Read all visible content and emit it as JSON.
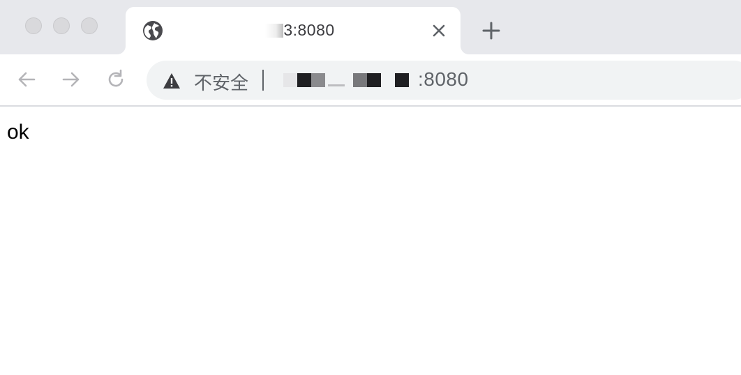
{
  "window": {
    "traffic_lights": [
      "close",
      "minimize",
      "zoom"
    ]
  },
  "tab": {
    "favicon_icon": "globe-icon",
    "title": "3:8080",
    "close_icon": "close-icon"
  },
  "new_tab_icon": "plus-icon",
  "nav": {
    "back_icon": "arrow-left-icon",
    "forward_icon": "arrow-right-icon",
    "reload_icon": "reload-icon"
  },
  "omnibox": {
    "security_icon": "warning-triangle-icon",
    "security_label": "不安全",
    "url_port": ":8080"
  },
  "page": {
    "body_text": "ok"
  },
  "colors": {
    "tabstrip_bg": "#e7e8ec",
    "omnibox_bg": "#f1f3f4",
    "icon_dark": "#5f6368",
    "icon_disabled": "#b4b4b8"
  }
}
